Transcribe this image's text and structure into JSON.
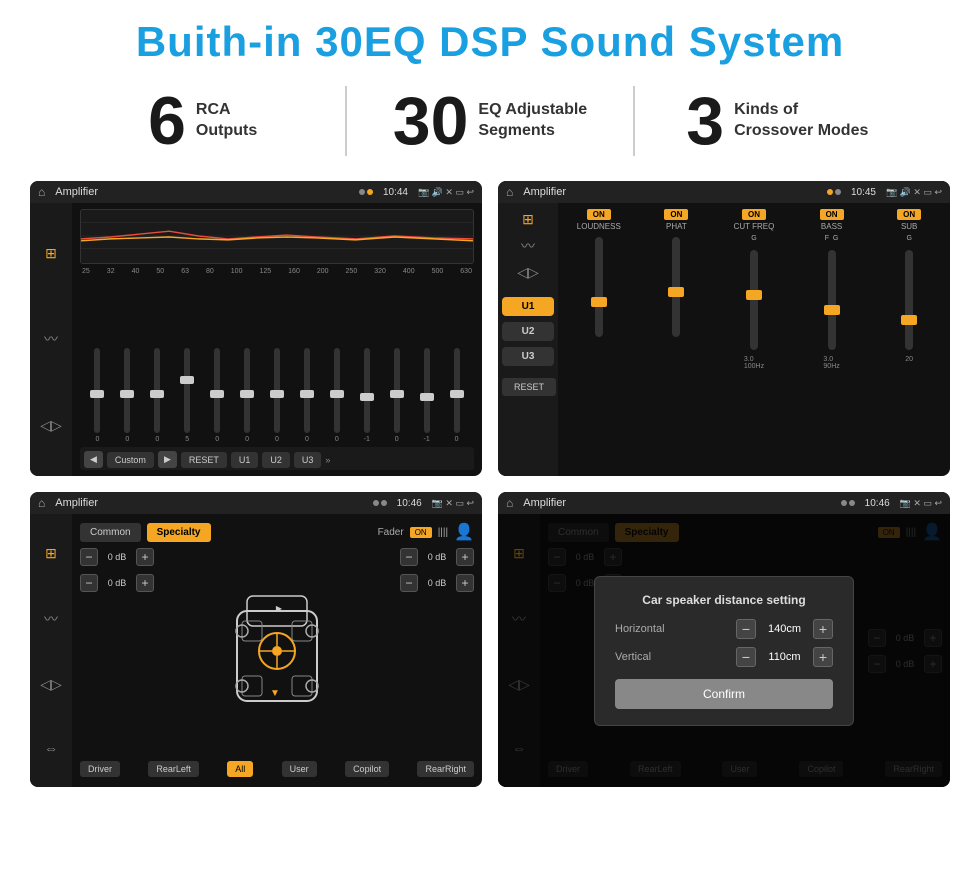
{
  "header": {
    "title": "Buith-in 30EQ DSP Sound System"
  },
  "stats": [
    {
      "number": "6",
      "label": "RCA\nOutputs"
    },
    {
      "number": "30",
      "label": "EQ Adjustable\nSegments"
    },
    {
      "number": "3",
      "label": "Kinds of\nCrossover Modes"
    }
  ],
  "screen1": {
    "status_title": "Amplifier",
    "time": "10:44",
    "eq_frequencies": [
      "25",
      "32",
      "40",
      "50",
      "63",
      "80",
      "100",
      "125",
      "160",
      "200",
      "250",
      "320",
      "400",
      "500",
      "630"
    ],
    "eq_values": [
      "0",
      "0",
      "0",
      "5",
      "0",
      "0",
      "0",
      "0",
      "0",
      "0",
      "-1",
      "0",
      "-1"
    ],
    "preset_label": "Custom",
    "buttons": [
      "RESET",
      "U1",
      "U2",
      "U3"
    ]
  },
  "screen2": {
    "status_title": "Amplifier",
    "time": "10:45",
    "presets": [
      "U1",
      "U2",
      "U3"
    ],
    "controls": [
      {
        "label": "LOUDNESS",
        "on": true
      },
      {
        "label": "PHAT",
        "on": true
      },
      {
        "label": "CUT FREQ",
        "on": true
      },
      {
        "label": "BASS",
        "on": true
      },
      {
        "label": "SUB",
        "on": true
      }
    ],
    "reset_label": "RESET"
  },
  "screen3": {
    "status_title": "Amplifier",
    "time": "10:46",
    "tabs": [
      "Common",
      "Specialty"
    ],
    "fader_label": "Fader",
    "fader_on": true,
    "volumes": [
      {
        "value": "0 dB"
      },
      {
        "value": "0 dB"
      },
      {
        "value": "0 dB"
      },
      {
        "value": "0 dB"
      }
    ],
    "bottom_buttons": [
      "Driver",
      "RearLeft",
      "All",
      "User",
      "Copilot",
      "RearRight"
    ]
  },
  "screen4": {
    "status_title": "Amplifier",
    "time": "10:46",
    "tabs": [
      "Common",
      "Specialty"
    ],
    "dialog": {
      "title": "Car speaker distance setting",
      "fields": [
        {
          "label": "Horizontal",
          "value": "140cm"
        },
        {
          "label": "Vertical",
          "value": "110cm"
        }
      ],
      "confirm_label": "Confirm"
    },
    "side_volumes": [
      {
        "value": "0 dB"
      },
      {
        "value": "0 dB"
      }
    ],
    "bottom_buttons": [
      "Driver",
      "RearLeft",
      "All",
      "User",
      "Copilot",
      "RearRight"
    ]
  }
}
